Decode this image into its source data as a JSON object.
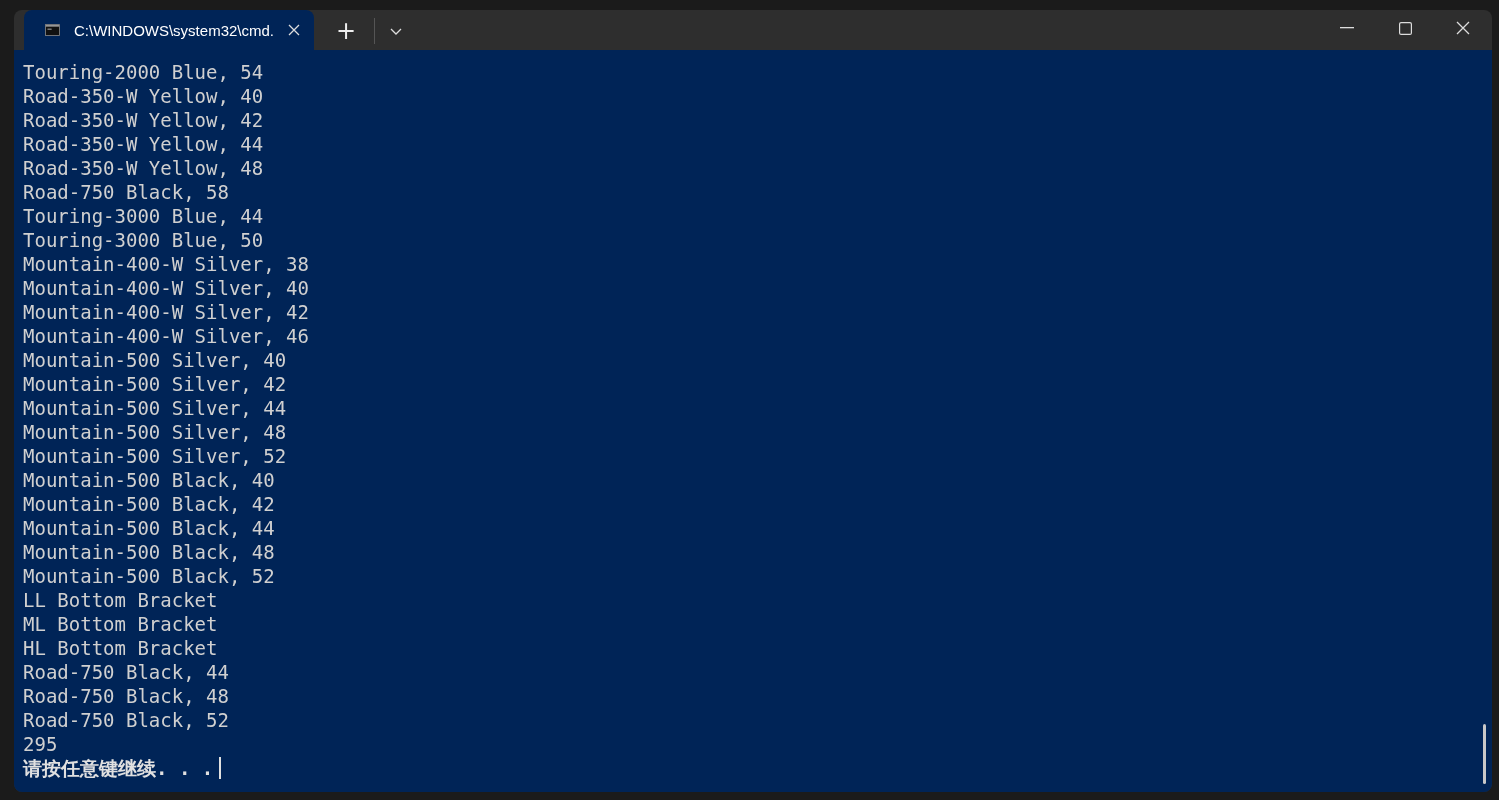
{
  "window": {
    "tabs": [
      {
        "title": "C:\\WINDOWS\\system32\\cmd.",
        "selected": true
      }
    ],
    "new_tab_button": "+"
  },
  "console": {
    "lines": [
      "Touring-2000 Blue, 54",
      "Road-350-W Yellow, 40",
      "Road-350-W Yellow, 42",
      "Road-350-W Yellow, 44",
      "Road-350-W Yellow, 48",
      "Road-750 Black, 58",
      "Touring-3000 Blue, 44",
      "Touring-3000 Blue, 50",
      "Mountain-400-W Silver, 38",
      "Mountain-400-W Silver, 40",
      "Mountain-400-W Silver, 42",
      "Mountain-400-W Silver, 46",
      "Mountain-500 Silver, 40",
      "Mountain-500 Silver, 42",
      "Mountain-500 Silver, 44",
      "Mountain-500 Silver, 48",
      "Mountain-500 Silver, 52",
      "Mountain-500 Black, 40",
      "Mountain-500 Black, 42",
      "Mountain-500 Black, 44",
      "Mountain-500 Black, 48",
      "Mountain-500 Black, 52",
      "LL Bottom Bracket",
      "ML Bottom Bracket",
      "HL Bottom Bracket",
      "Road-750 Black, 44",
      "Road-750 Black, 48",
      "Road-750 Black, 52",
      "295"
    ],
    "prompt": "请按任意键继续. . ."
  }
}
